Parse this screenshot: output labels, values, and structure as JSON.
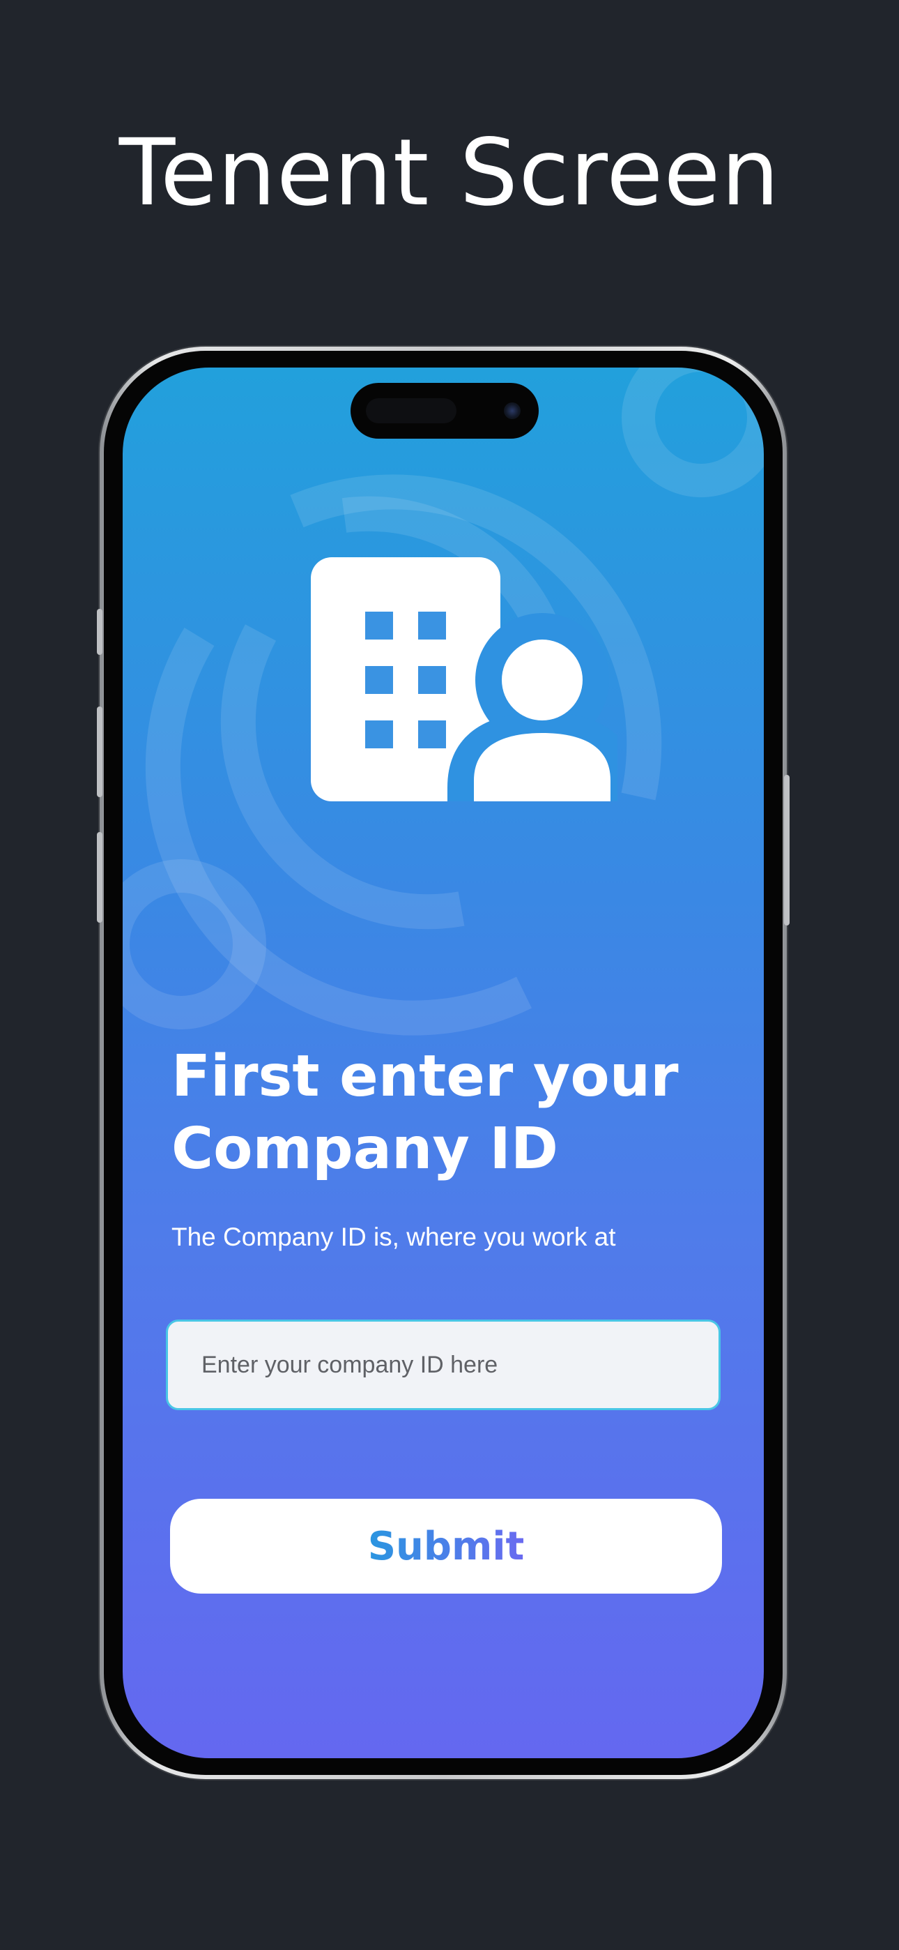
{
  "page": {
    "title": "Tenent Screen"
  },
  "screen": {
    "headline_line1": "First enter your",
    "headline_line2": "Company ID",
    "subtext": "The Company ID is, where you work at",
    "company_id_input": {
      "value": "",
      "placeholder": "Enter your company ID here"
    },
    "submit_label": "Submit",
    "hero_icon": "building-user-icon"
  },
  "colors": {
    "background": "#21252c",
    "gradient_top": "#22a0dc",
    "gradient_bottom": "#6468f0",
    "input_border": "#49c6e6",
    "button_text_start": "#2a96e0",
    "button_text_end": "#6a6af0"
  }
}
